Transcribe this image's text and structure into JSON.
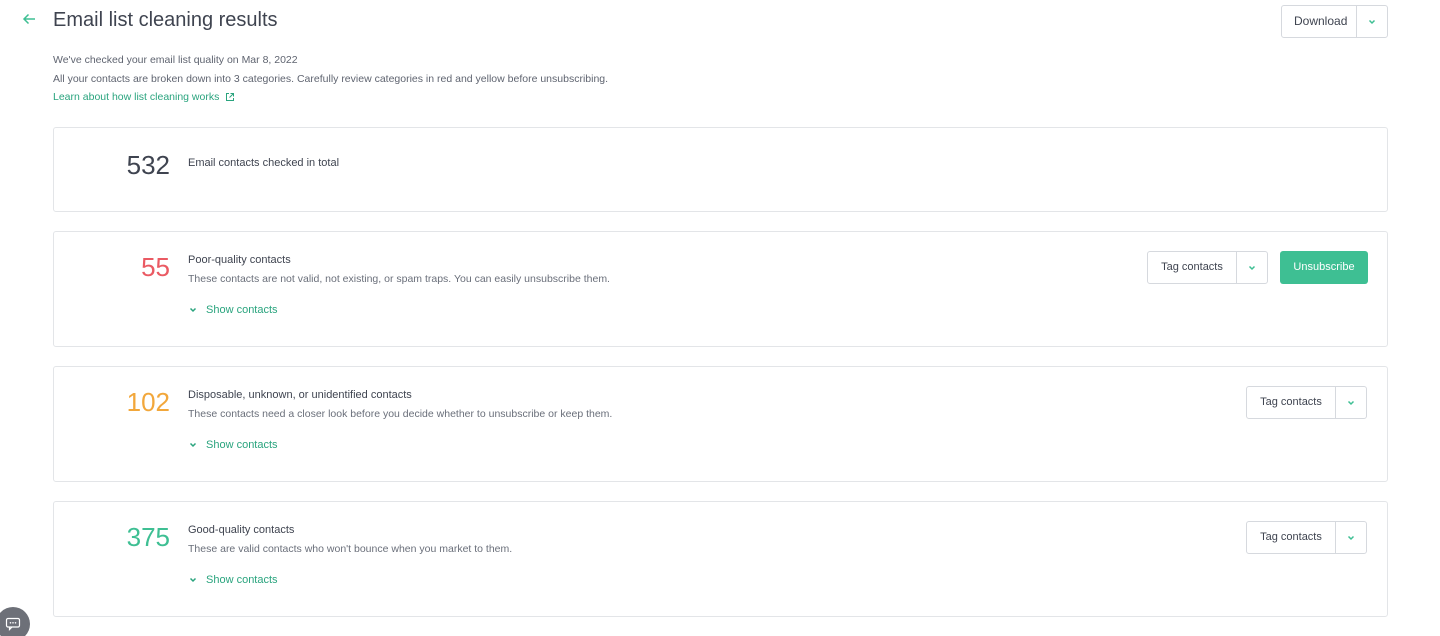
{
  "header": {
    "title": "Email list cleaning results",
    "download_label": "Download"
  },
  "intro": {
    "line1": "We've checked your email list quality on Mar 8, 2022",
    "line2": "All your contacts are broken down into 3 categories. Carefully review categories in red and yellow before unsubscribing.",
    "learn_link": "Learn about how list cleaning works"
  },
  "total": {
    "count": "532",
    "label": "Email contacts checked in total"
  },
  "categories": [
    {
      "count": "55",
      "title": "Poor-quality contacts",
      "description": "These contacts are not valid, not existing, or spam traps. You can easily unsubscribe them.",
      "show_label": "Show contacts",
      "tag_label": "Tag contacts",
      "unsubscribe_label": "Unsubscribe",
      "color": "#ea5a63"
    },
    {
      "count": "102",
      "title": "Disposable, unknown, or unidentified contacts",
      "description": "These contacts need a closer look before you decide whether to unsubscribe or keep them.",
      "show_label": "Show contacts",
      "tag_label": "Tag contacts",
      "color": "#f2a73b"
    },
    {
      "count": "375",
      "title": "Good-quality contacts",
      "description": "These are valid contacts who won't bounce when you market to them.",
      "show_label": "Show contacts",
      "tag_label": "Tag contacts",
      "color": "#3ebf93"
    }
  ],
  "colors": {
    "accent": "#3ebf93",
    "link": "#2aa47e",
    "border": "#e3e5e8"
  },
  "icons": {
    "back": "arrow-left-icon",
    "external": "external-link-icon",
    "caret": "chevron-down-icon",
    "chat": "chat-icon"
  }
}
